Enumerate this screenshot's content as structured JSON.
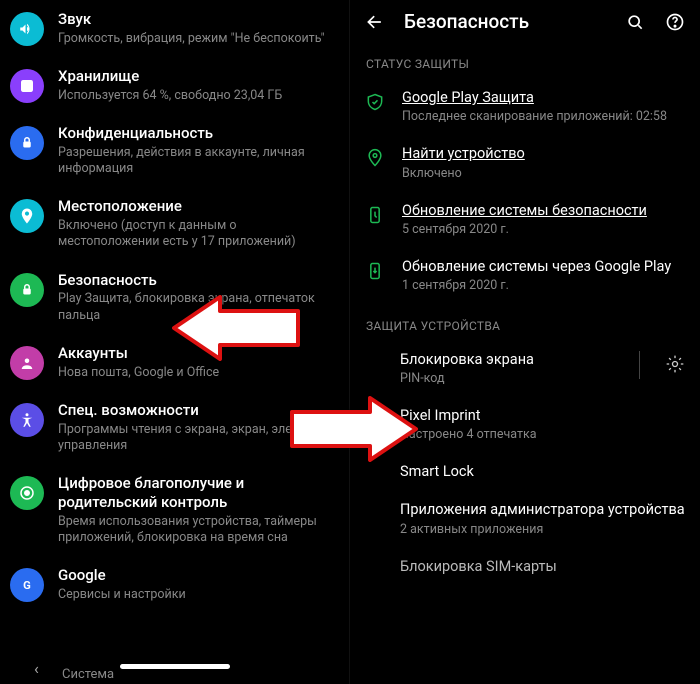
{
  "left": {
    "items": [
      {
        "title": "Звук",
        "sub": "Громкость, вибрация, режим \"Не беспокоить\"",
        "color": "#0bbcd4"
      },
      {
        "title": "Хранилище",
        "sub": "Используется 64 %, свободно 23,04 ГБ",
        "color": "#8a3ffc"
      },
      {
        "title": "Конфиденциальность",
        "sub": "Разрешения, действия в аккаунте, личная информация",
        "color": "#2a6cf0"
      },
      {
        "title": "Местоположение",
        "sub": "Включено (доступ к данным о местоположении есть у 17 приложений)",
        "color": "#0bbcd4"
      },
      {
        "title": "Безопасность",
        "sub": "Play Защита, блокировка экрана, отпечаток пальца",
        "color": "#1db954"
      },
      {
        "title": "Аккаунты",
        "sub": "Нова пошта, Google и Office",
        "color": "#c23da8"
      },
      {
        "title": "Спец. возможности",
        "sub": "Программы чтения с экрана, экран, элементы управления",
        "color": "#5b4ee6"
      },
      {
        "title": "Цифровое благополучие и родительский контроль",
        "sub": "Время использования устройства, таймеры приложений, блокировка на время сна",
        "color": "#1db954"
      },
      {
        "title": "Google",
        "sub": "Сервисы и настройки",
        "color": "#2a6cf0"
      }
    ],
    "system_label": "Система"
  },
  "right": {
    "header": "Безопасность",
    "section1": "СТАТУС ЗАЩИТЫ",
    "status": [
      {
        "title": "Google Play Защита",
        "sub": "Последнее сканирование приложений: 02:58",
        "underlined": true,
        "icon": "shield"
      },
      {
        "title": "Найти устройство",
        "sub": "Включено",
        "underlined": true,
        "icon": "pin"
      },
      {
        "title": "Обновление системы безопасности",
        "sub": "5 сентября 2020 г.",
        "underlined": true,
        "icon": "update"
      },
      {
        "title": "Обновление системы через Google Play",
        "sub": "1 сентября 2020 г.",
        "underlined": false,
        "icon": "update"
      }
    ],
    "section2": "ЗАЩИТА УСТРОЙСТВА",
    "device": [
      {
        "title": "Блокировка экрана",
        "sub": "PIN-код",
        "gear": true
      },
      {
        "title": "Pixel Imprint",
        "sub": "Настроено 4 отпечатка"
      },
      {
        "title": "Smart Lock",
        "sub": ""
      },
      {
        "title": "Приложения администратора устройства",
        "sub": "2 активных приложения"
      }
    ],
    "bottom_partial": "Блокировка SIM-карты"
  }
}
